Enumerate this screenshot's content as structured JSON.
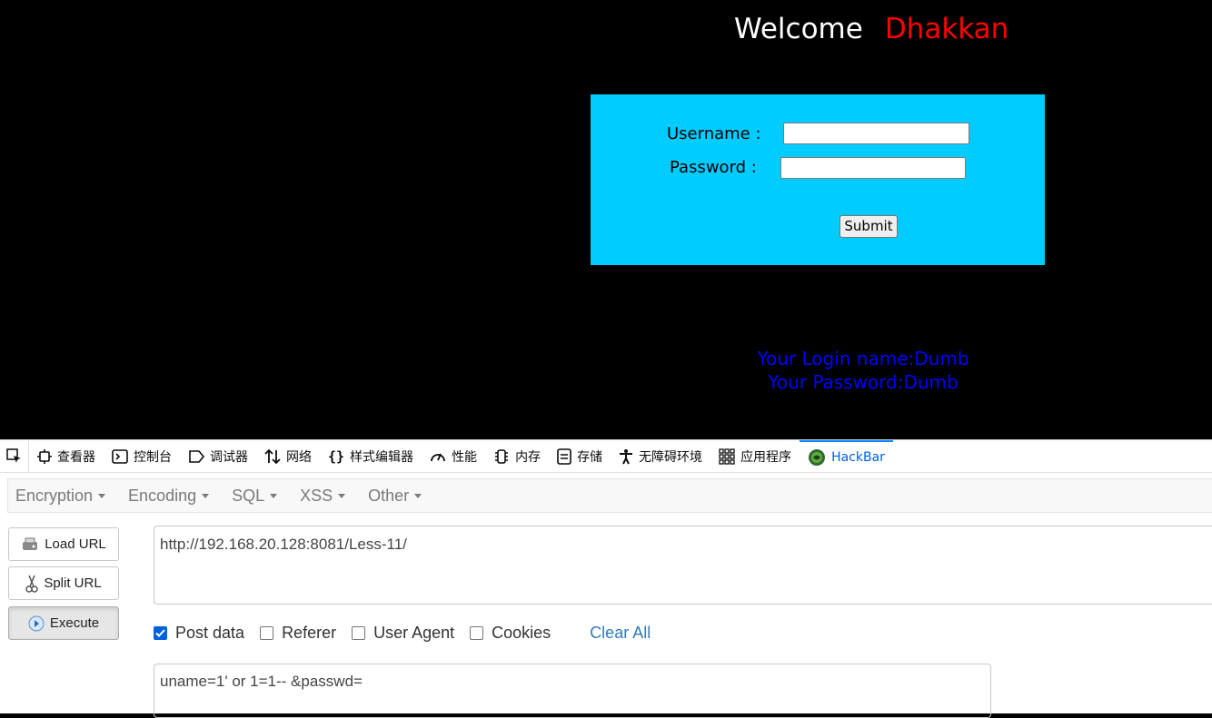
{
  "page": {
    "welcome": "Welcome",
    "welcome_name": "Dhakkan",
    "form": {
      "username_label": "Username :",
      "password_label": "Password :",
      "submit_label": "Submit"
    },
    "result": {
      "login_name": "Your Login name:Dumb",
      "password": "Your Password:Dumb"
    },
    "colors": {
      "background": "#000000",
      "form_bg": "#00ccff",
      "name": "#ff0000",
      "result": "#0000ff"
    }
  },
  "devtools": {
    "tabs": [
      {
        "label": "查看器",
        "icon": "inspector-icon"
      },
      {
        "label": "控制台",
        "icon": "console-icon"
      },
      {
        "label": "调试器",
        "icon": "debugger-icon"
      },
      {
        "label": "网络",
        "icon": "network-icon"
      },
      {
        "label": "样式编辑器",
        "icon": "style-editor-icon"
      },
      {
        "label": "性能",
        "icon": "performance-icon"
      },
      {
        "label": "内存",
        "icon": "memory-icon"
      },
      {
        "label": "存储",
        "icon": "storage-icon"
      },
      {
        "label": "无障碍环境",
        "icon": "accessibility-icon"
      },
      {
        "label": "应用程序",
        "icon": "application-icon"
      },
      {
        "label": "HackBar",
        "icon": "hackbar-icon",
        "active": true
      }
    ]
  },
  "hackbar": {
    "menu": [
      "Encryption",
      "Encoding",
      "SQL",
      "XSS",
      "Other"
    ],
    "buttons": {
      "load": "Load URL",
      "split": "Split URL",
      "execute": "Execute"
    },
    "url": "http://192.168.20.128:8081/Less-11/",
    "options": {
      "post_data": {
        "label": "Post data",
        "checked": true
      },
      "referer": {
        "label": "Referer",
        "checked": false
      },
      "user_agent": {
        "label": "User Agent",
        "checked": false
      },
      "cookies": {
        "label": "Cookies",
        "checked": false
      },
      "clear_all": "Clear All"
    },
    "post_body": "uname=1' or 1=1-- &passwd="
  }
}
